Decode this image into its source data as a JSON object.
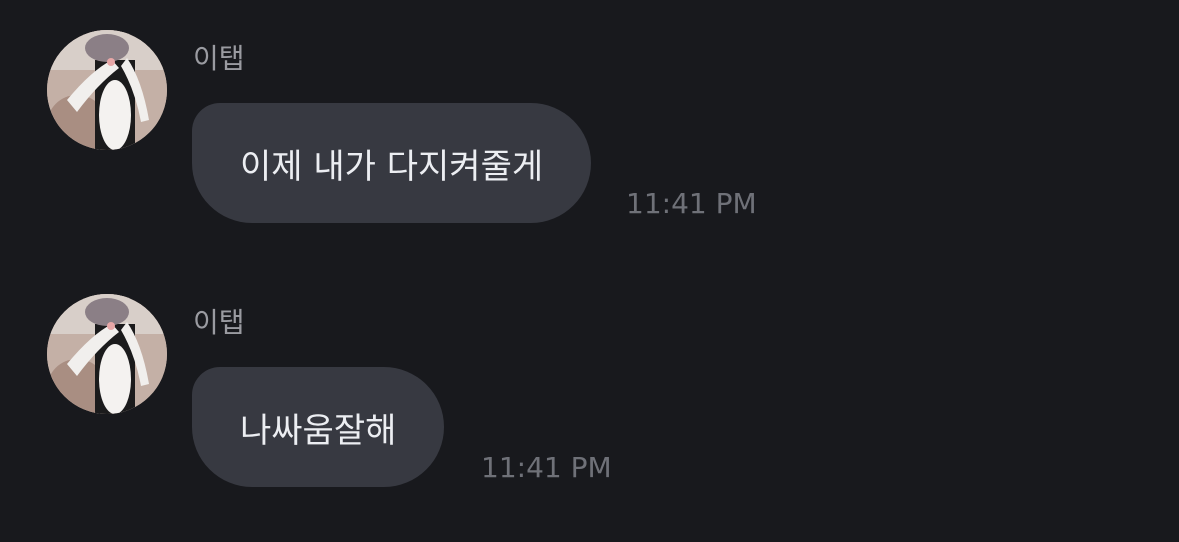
{
  "messages": [
    {
      "sender": "이탭",
      "text": "이제 내가 다지켜줄게",
      "time": "11:41 PM"
    },
    {
      "sender": "이탭",
      "text": "나싸움잘해",
      "time": "11:41 PM"
    }
  ],
  "colors": {
    "background": "#18191d",
    "bubble": "#373941",
    "message_text": "#eceef2",
    "sender_text": "#9a9ba1",
    "time_text": "#6f7178"
  }
}
